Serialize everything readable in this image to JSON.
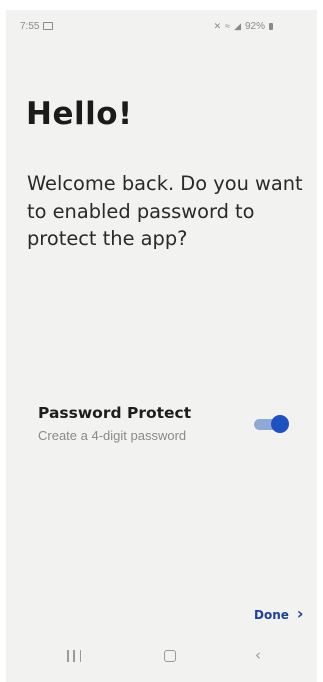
{
  "status_bar": {
    "time": "7:55",
    "battery": "92%"
  },
  "content": {
    "title": "Hello!",
    "message": "Welcome back. Do you want to enabled password to protect the app?"
  },
  "setting": {
    "title": "Password Protect",
    "subtitle": "Create a 4-digit password",
    "enabled": true
  },
  "actions": {
    "done_label": "Done",
    "done_arrow": "›"
  },
  "nav": {
    "back_glyph": "‹"
  },
  "colors": {
    "background": "#f2f2f1",
    "accent": "#1c52c2",
    "toggle_track": "#8fa8d6",
    "done_text": "#1e3f9c"
  },
  "icons": {
    "status": [
      "message-icon",
      "mute-icon",
      "wifi-icon",
      "signal-icon",
      "battery-icon"
    ],
    "nav": [
      "recents-icon",
      "home-icon",
      "back-icon"
    ]
  }
}
